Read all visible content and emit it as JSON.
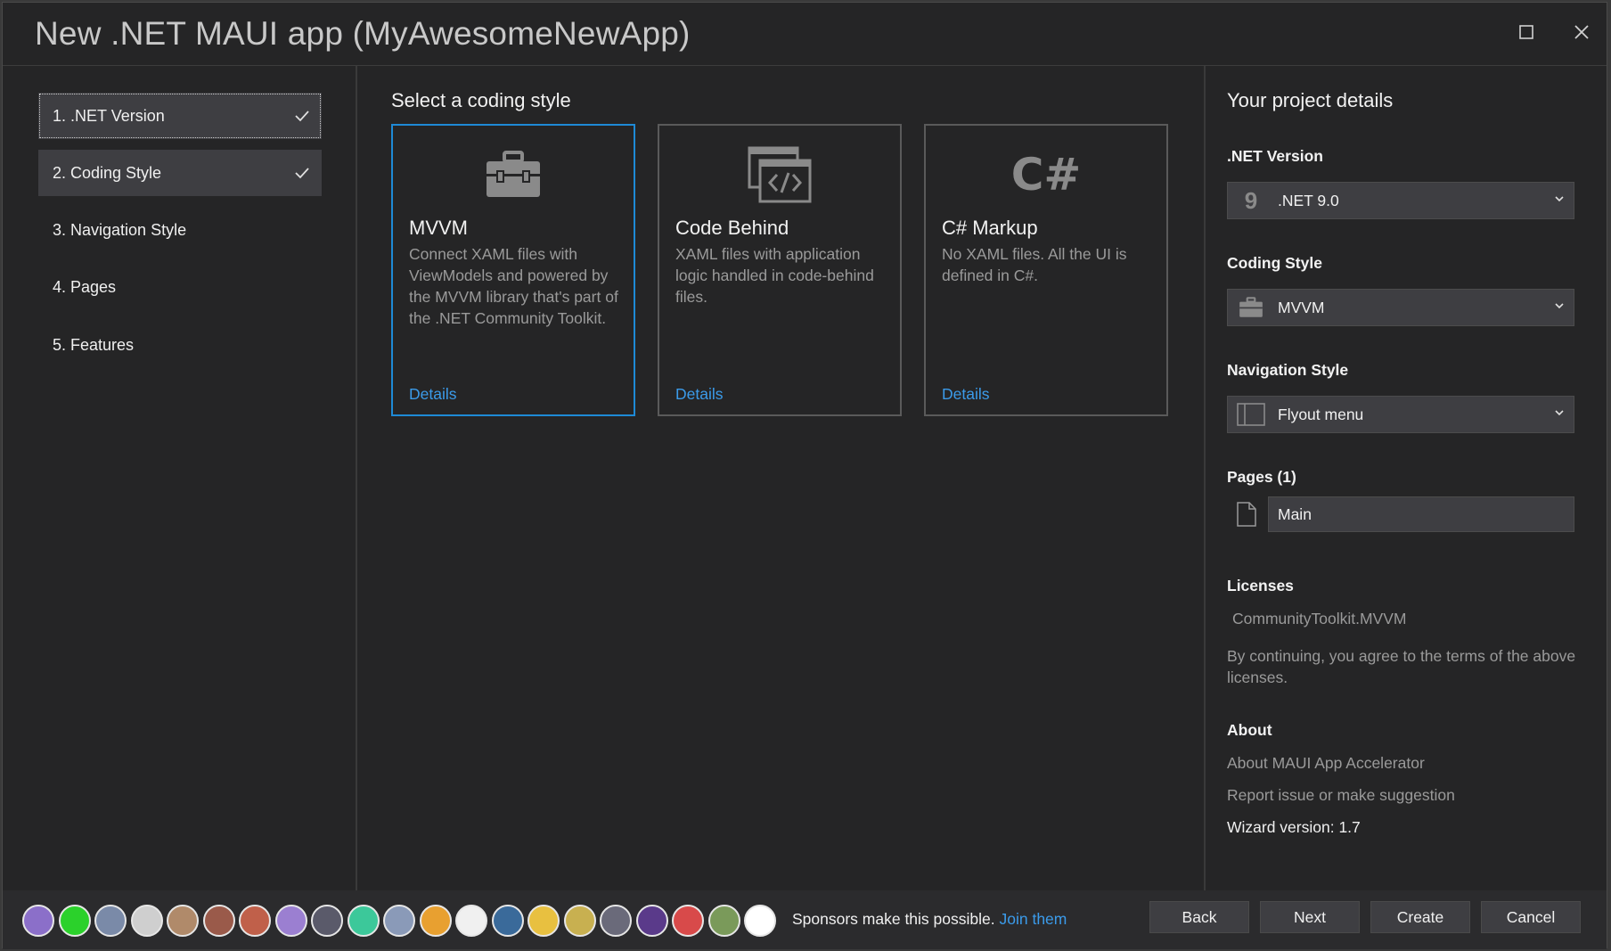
{
  "window": {
    "title": "New .NET MAUI app (MyAwesomeNewApp)"
  },
  "steps": [
    {
      "label": "1. .NET Version",
      "done": true
    },
    {
      "label": "2. Coding Style",
      "done": true
    },
    {
      "label": "3. Navigation Style",
      "done": false
    },
    {
      "label": "4. Pages",
      "done": false
    },
    {
      "label": "5. Features",
      "done": false
    }
  ],
  "main": {
    "title": "Select a coding style",
    "cards": [
      {
        "name": "MVVM",
        "description": "Connect XAML files with ViewModels and powered by the MVVM library that's part of the .NET Community Toolkit.",
        "details": "Details",
        "icon": "toolbox-icon",
        "selected": true
      },
      {
        "name": "Code Behind",
        "description": "XAML files with application logic handled in code-behind files.",
        "details": "Details",
        "icon": "code-window-icon",
        "selected": false
      },
      {
        "name": "C# Markup",
        "description": "No XAML files. All the UI is defined in C#.",
        "details": "Details",
        "icon": "csharp-icon",
        "icon_text": "C#",
        "selected": false
      }
    ]
  },
  "details": {
    "title": "Your project details",
    "net_version": {
      "label": ".NET Version",
      "value": ".NET 9.0",
      "icon_text": "9"
    },
    "coding_style": {
      "label": "Coding Style",
      "value": "MVVM"
    },
    "navigation_style": {
      "label": "Navigation Style",
      "value": "Flyout menu"
    },
    "pages": {
      "label": "Pages (1)",
      "items": [
        "Main"
      ]
    },
    "licenses": {
      "label": "Licenses",
      "link": "CommunityToolkit.MVVM",
      "text": "By continuing, you agree to the terms of the above licenses."
    },
    "about": {
      "label": "About",
      "link1": "About MAUI App Accelerator",
      "link2": "Report issue or make suggestion",
      "version": "Wizard version: 1.7"
    }
  },
  "footer": {
    "sponsor_text": "Sponsors make this possible.",
    "join_link": "Join them",
    "avatar_colors": [
      "#8b6fc9",
      "#2bd12b",
      "#7a8aa8",
      "#cfcfcf",
      "#b08a6a",
      "#9a5a4a",
      "#c0604a",
      "#9b7fd1",
      "#5a5a6a",
      "#3cc89a",
      "#8a9ab8",
      "#e8a030",
      "#f0f0f0",
      "#3a6a9a",
      "#e8c040",
      "#c8b050",
      "#6a6a7a",
      "#5a3a8a",
      "#d84a4a",
      "#7a9a5a",
      "#ffffff"
    ],
    "buttons": {
      "back": "Back",
      "next": "Next",
      "create": "Create",
      "cancel": "Cancel"
    }
  },
  "colors": {
    "accent": "#1e8ad6",
    "link": "#3b9bea",
    "background": "#252526"
  }
}
